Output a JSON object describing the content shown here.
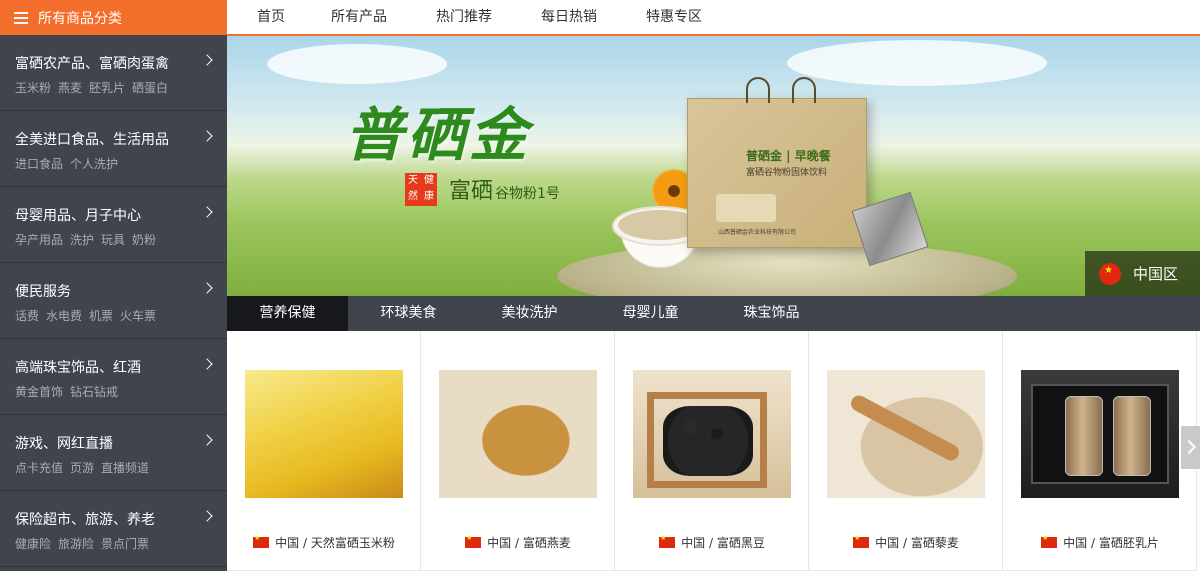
{
  "header": {
    "all_categories": "所有商品分类"
  },
  "topnav": [
    "首页",
    "所有产品",
    "热门推荐",
    "每日热销",
    "特惠专区"
  ],
  "sidebar": [
    {
      "title": "富硒农产品、富硒肉蛋禽",
      "subs": [
        "玉米粉",
        "燕麦",
        "胚乳片",
        "硒蛋白"
      ]
    },
    {
      "title": "全美进口食品、生活用品",
      "subs": [
        "进口食品",
        "个人洗护"
      ]
    },
    {
      "title": "母婴用品、月子中心",
      "subs": [
        "孕产用品",
        "洗护",
        "玩具",
        "奶粉"
      ]
    },
    {
      "title": "便民服务",
      "subs": [
        "话费",
        "水电费",
        "机票",
        "火车票"
      ]
    },
    {
      "title": "高端珠宝饰品、红酒",
      "subs": [
        "黄金首饰",
        "钻石钻戒"
      ]
    },
    {
      "title": "游戏、网红直播",
      "subs": [
        "点卡充值",
        "页游",
        "直播频道"
      ]
    },
    {
      "title": "保险超市、旅游、养老",
      "subs": [
        "健康险",
        "旅游险",
        "景点门票"
      ]
    }
  ],
  "banner": {
    "brand": "普硒金",
    "badge": [
      "天",
      "健",
      "然",
      "康"
    ],
    "slogan_big": "富硒",
    "slogan_small": "谷物粉1号",
    "bag_brand": "普硒金 | 早晚餐",
    "bag_line": "富硒谷物粉固体饮料",
    "bag_company": "山西普硒金农业科技有限公司",
    "region": "中国区"
  },
  "tabs": [
    "营养保健",
    "环球美食",
    "美妆洗护",
    "母婴儿童",
    "珠宝饰品"
  ],
  "active_tab": 0,
  "products": [
    {
      "country": "中国",
      "name": "天然富硒玉米粉",
      "image": "corn-flour"
    },
    {
      "country": "中国",
      "name": "富硒燕麦",
      "image": "oats"
    },
    {
      "country": "中国",
      "name": "富硒黑豆",
      "image": "black-beans"
    },
    {
      "country": "中国",
      "name": "富硒藜麦",
      "image": "quinoa"
    },
    {
      "country": "中国",
      "name": "富硒胚乳片",
      "image": "germ-flakes"
    }
  ],
  "colors": {
    "accent": "#f46e2b",
    "sidebar_bg": "#3f444d",
    "tab_active": "#16181b"
  }
}
